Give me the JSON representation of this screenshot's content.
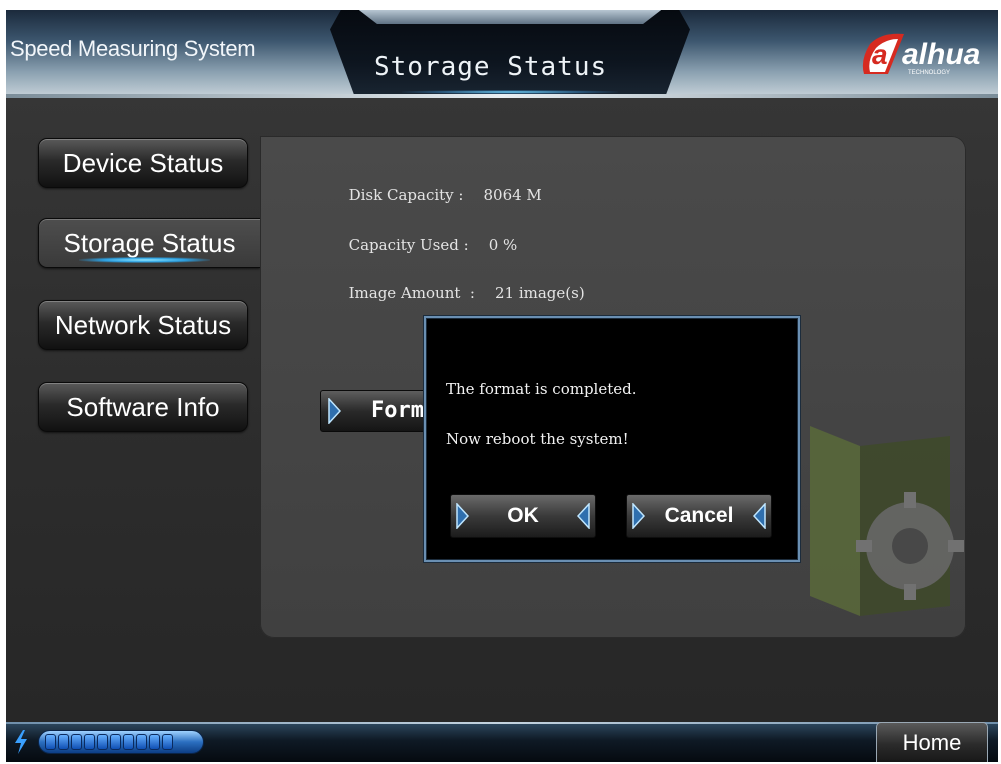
{
  "header": {
    "app_title": "Speed Measuring System",
    "page_title": "Storage Status",
    "logo_text": "alhua",
    "logo_subtext": "TECHNOLOGY"
  },
  "nav": {
    "items": [
      {
        "label": "Device Status",
        "active": false
      },
      {
        "label": "Storage Status",
        "active": true
      },
      {
        "label": "Network Status",
        "active": false
      },
      {
        "label": "Software Info",
        "active": false
      }
    ]
  },
  "storage": {
    "disk_capacity_label": "Disk Capacity :",
    "disk_capacity_value": "8064 M",
    "capacity_used_label": "Capacity Used :",
    "capacity_used_value": "0 %",
    "image_amount_label": "Image Amount  :",
    "image_amount_value": "21 image(s)",
    "format_button_label": "Format"
  },
  "dialog": {
    "line1": "The format is completed.",
    "line2": "Now reboot the system!",
    "ok_label": "OK",
    "cancel_label": "Cancel"
  },
  "footer": {
    "home_label": "Home",
    "progress_segments": 10
  },
  "colors": {
    "accent_blue": "#2c9fe0",
    "dialog_border": "#6a8fb2",
    "logo_red": "#d62a20"
  },
  "icons": {
    "bolt": "lightning-bolt-icon",
    "arrow_right": "play-right-icon",
    "arrow_left": "play-left-icon",
    "folder": "folder-gear-icon"
  }
}
